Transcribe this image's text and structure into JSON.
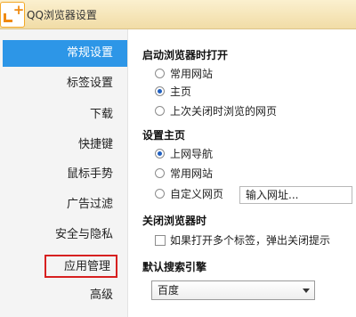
{
  "window": {
    "title": "QQ浏览器设置"
  },
  "sidebar": {
    "items": [
      {
        "label": "常规设置"
      },
      {
        "label": "标签设置"
      },
      {
        "label": "下载"
      },
      {
        "label": "快捷键"
      },
      {
        "label": "鼠标手势"
      },
      {
        "label": "广告过滤"
      },
      {
        "label": "安全与隐私"
      },
      {
        "label": "应用管理"
      },
      {
        "label": "高级"
      }
    ],
    "selected": "常规设置",
    "highlighted": "应用管理",
    "accent_color": "#2d96e7",
    "highlight_border_color": "#d72020"
  },
  "startup": {
    "title": "启动浏览器时打开",
    "options": [
      "常用网站",
      "主页",
      "上次关闭时浏览的网页"
    ],
    "selected": "主页"
  },
  "homepage": {
    "title": "设置主页",
    "options": [
      "上网导航",
      "常用网站",
      "自定义网页"
    ],
    "selected": "上网导航",
    "url_placeholder": "输入网址..."
  },
  "close": {
    "title": "关闭浏览器时",
    "checkbox_label": "如果打开多个标签，弹出关闭提示",
    "checked": false
  },
  "search": {
    "title": "默认搜索引擎",
    "selected": "百度"
  }
}
